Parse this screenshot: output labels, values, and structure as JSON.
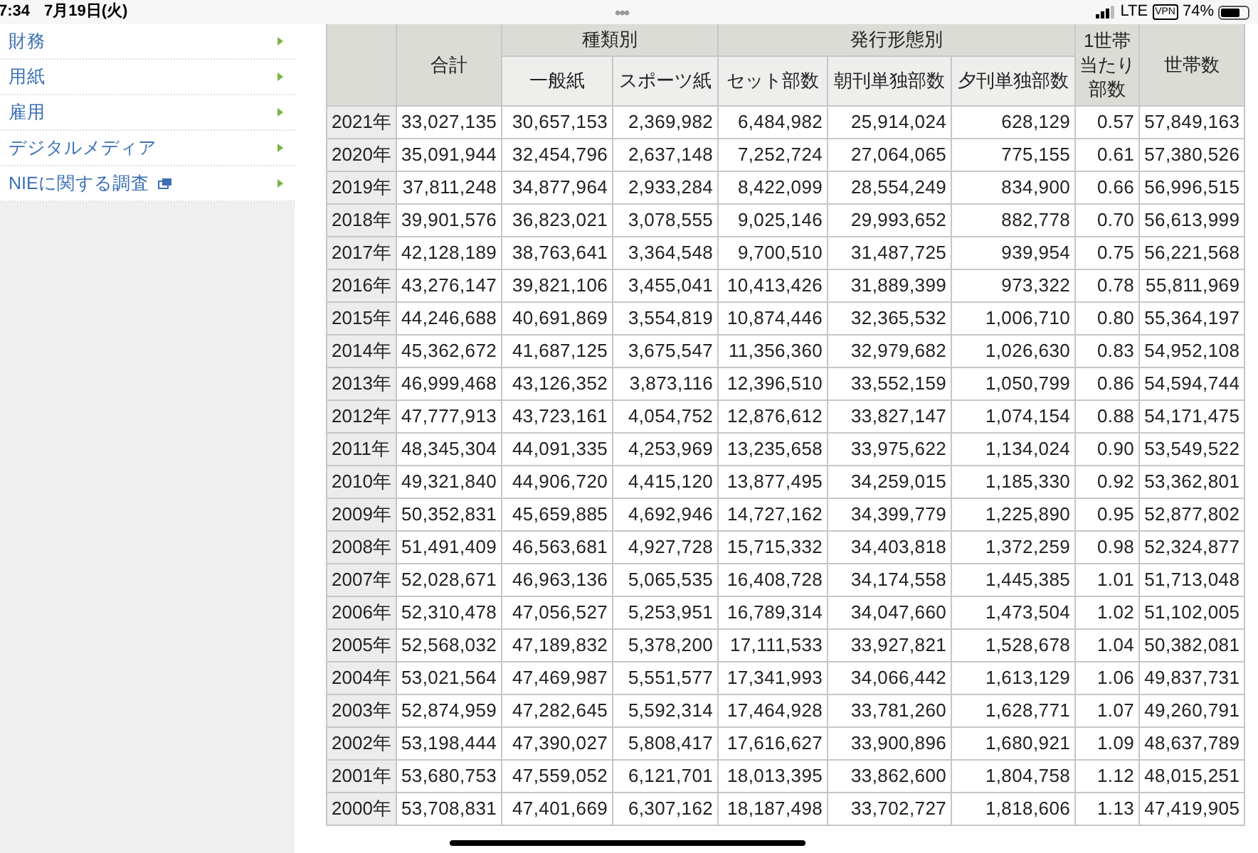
{
  "status_bar": {
    "time": "7:34",
    "date": "7月19日(火)",
    "network": "LTE",
    "vpn": "VPN",
    "battery": "74%"
  },
  "top_dots": "•••",
  "sidebar": {
    "items": [
      {
        "label": "財務",
        "kind": "link"
      },
      {
        "label": "用紙",
        "kind": "link"
      },
      {
        "label": "雇用",
        "kind": "link"
      },
      {
        "label": "デジタルメディア",
        "kind": "link"
      },
      {
        "label": "NIEに関する調査",
        "kind": "external"
      }
    ]
  },
  "table": {
    "header_groups": [
      {
        "label": "合計"
      },
      {
        "label": "種類別",
        "columns": [
          "一般紙",
          "スポーツ紙"
        ]
      },
      {
        "label": "発行形態別",
        "columns": [
          "セット部数",
          "朝刊単独部数",
          "夕刊単独部数"
        ]
      },
      {
        "label": "1世帯当たり部数"
      },
      {
        "label": "世帯数"
      }
    ],
    "rows": [
      {
        "year": "2021年",
        "cells": [
          "33,027,135",
          "30,657,153",
          "2,369,982",
          "6,484,982",
          "25,914,024",
          "628,129",
          "0.57",
          "57,849,163"
        ]
      },
      {
        "year": "2020年",
        "cells": [
          "35,091,944",
          "32,454,796",
          "2,637,148",
          "7,252,724",
          "27,064,065",
          "775,155",
          "0.61",
          "57,380,526"
        ]
      },
      {
        "year": "2019年",
        "cells": [
          "37,811,248",
          "34,877,964",
          "2,933,284",
          "8,422,099",
          "28,554,249",
          "834,900",
          "0.66",
          "56,996,515"
        ]
      },
      {
        "year": "2018年",
        "cells": [
          "39,901,576",
          "36,823,021",
          "3,078,555",
          "9,025,146",
          "29,993,652",
          "882,778",
          "0.70",
          "56,613,999"
        ]
      },
      {
        "year": "2017年",
        "cells": [
          "42,128,189",
          "38,763,641",
          "3,364,548",
          "9,700,510",
          "31,487,725",
          "939,954",
          "0.75",
          "56,221,568"
        ]
      },
      {
        "year": "2016年",
        "cells": [
          "43,276,147",
          "39,821,106",
          "3,455,041",
          "10,413,426",
          "31,889,399",
          "973,322",
          "0.78",
          "55,811,969"
        ]
      },
      {
        "year": "2015年",
        "cells": [
          "44,246,688",
          "40,691,869",
          "3,554,819",
          "10,874,446",
          "32,365,532",
          "1,006,710",
          "0.80",
          "55,364,197"
        ]
      },
      {
        "year": "2014年",
        "cells": [
          "45,362,672",
          "41,687,125",
          "3,675,547",
          "11,356,360",
          "32,979,682",
          "1,026,630",
          "0.83",
          "54,952,108"
        ]
      },
      {
        "year": "2013年",
        "cells": [
          "46,999,468",
          "43,126,352",
          "3,873,116",
          "12,396,510",
          "33,552,159",
          "1,050,799",
          "0.86",
          "54,594,744"
        ]
      },
      {
        "year": "2012年",
        "cells": [
          "47,777,913",
          "43,723,161",
          "4,054,752",
          "12,876,612",
          "33,827,147",
          "1,074,154",
          "0.88",
          "54,171,475"
        ]
      },
      {
        "year": "2011年",
        "cells": [
          "48,345,304",
          "44,091,335",
          "4,253,969",
          "13,235,658",
          "33,975,622",
          "1,134,024",
          "0.90",
          "53,549,522"
        ]
      },
      {
        "year": "2010年",
        "cells": [
          "49,321,840",
          "44,906,720",
          "4,415,120",
          "13,877,495",
          "34,259,015",
          "1,185,330",
          "0.92",
          "53,362,801"
        ]
      },
      {
        "year": "2009年",
        "cells": [
          "50,352,831",
          "45,659,885",
          "4,692,946",
          "14,727,162",
          "34,399,779",
          "1,225,890",
          "0.95",
          "52,877,802"
        ]
      },
      {
        "year": "2008年",
        "cells": [
          "51,491,409",
          "46,563,681",
          "4,927,728",
          "15,715,332",
          "34,403,818",
          "1,372,259",
          "0.98",
          "52,324,877"
        ]
      },
      {
        "year": "2007年",
        "cells": [
          "52,028,671",
          "46,963,136",
          "5,065,535",
          "16,408,728",
          "34,174,558",
          "1,445,385",
          "1.01",
          "51,713,048"
        ]
      },
      {
        "year": "2006年",
        "cells": [
          "52,310,478",
          "47,056,527",
          "5,253,951",
          "16,789,314",
          "34,047,660",
          "1,473,504",
          "1.02",
          "51,102,005"
        ]
      },
      {
        "year": "2005年",
        "cells": [
          "52,568,032",
          "47,189,832",
          "5,378,200",
          "17,111,533",
          "33,927,821",
          "1,528,678",
          "1.04",
          "50,382,081"
        ]
      },
      {
        "year": "2004年",
        "cells": [
          "53,021,564",
          "47,469,987",
          "5,551,577",
          "17,341,993",
          "34,066,442",
          "1,613,129",
          "1.06",
          "49,837,731"
        ]
      },
      {
        "year": "2003年",
        "cells": [
          "52,874,959",
          "47,282,645",
          "5,592,314",
          "17,464,928",
          "33,781,260",
          "1,628,771",
          "1.07",
          "49,260,791"
        ]
      },
      {
        "year": "2002年",
        "cells": [
          "53,198,444",
          "47,390,027",
          "5,808,417",
          "17,616,627",
          "33,900,896",
          "1,680,921",
          "1.09",
          "48,637,789"
        ]
      },
      {
        "year": "2001年",
        "cells": [
          "53,680,753",
          "47,559,052",
          "6,121,701",
          "18,013,395",
          "33,862,600",
          "1,804,758",
          "1.12",
          "48,015,251"
        ]
      },
      {
        "year": "2000年",
        "cells": [
          "53,708,831",
          "47,401,669",
          "6,307,162",
          "18,187,498",
          "33,702,727",
          "1,818,606",
          "1.13",
          "47,419,905"
        ]
      }
    ]
  }
}
